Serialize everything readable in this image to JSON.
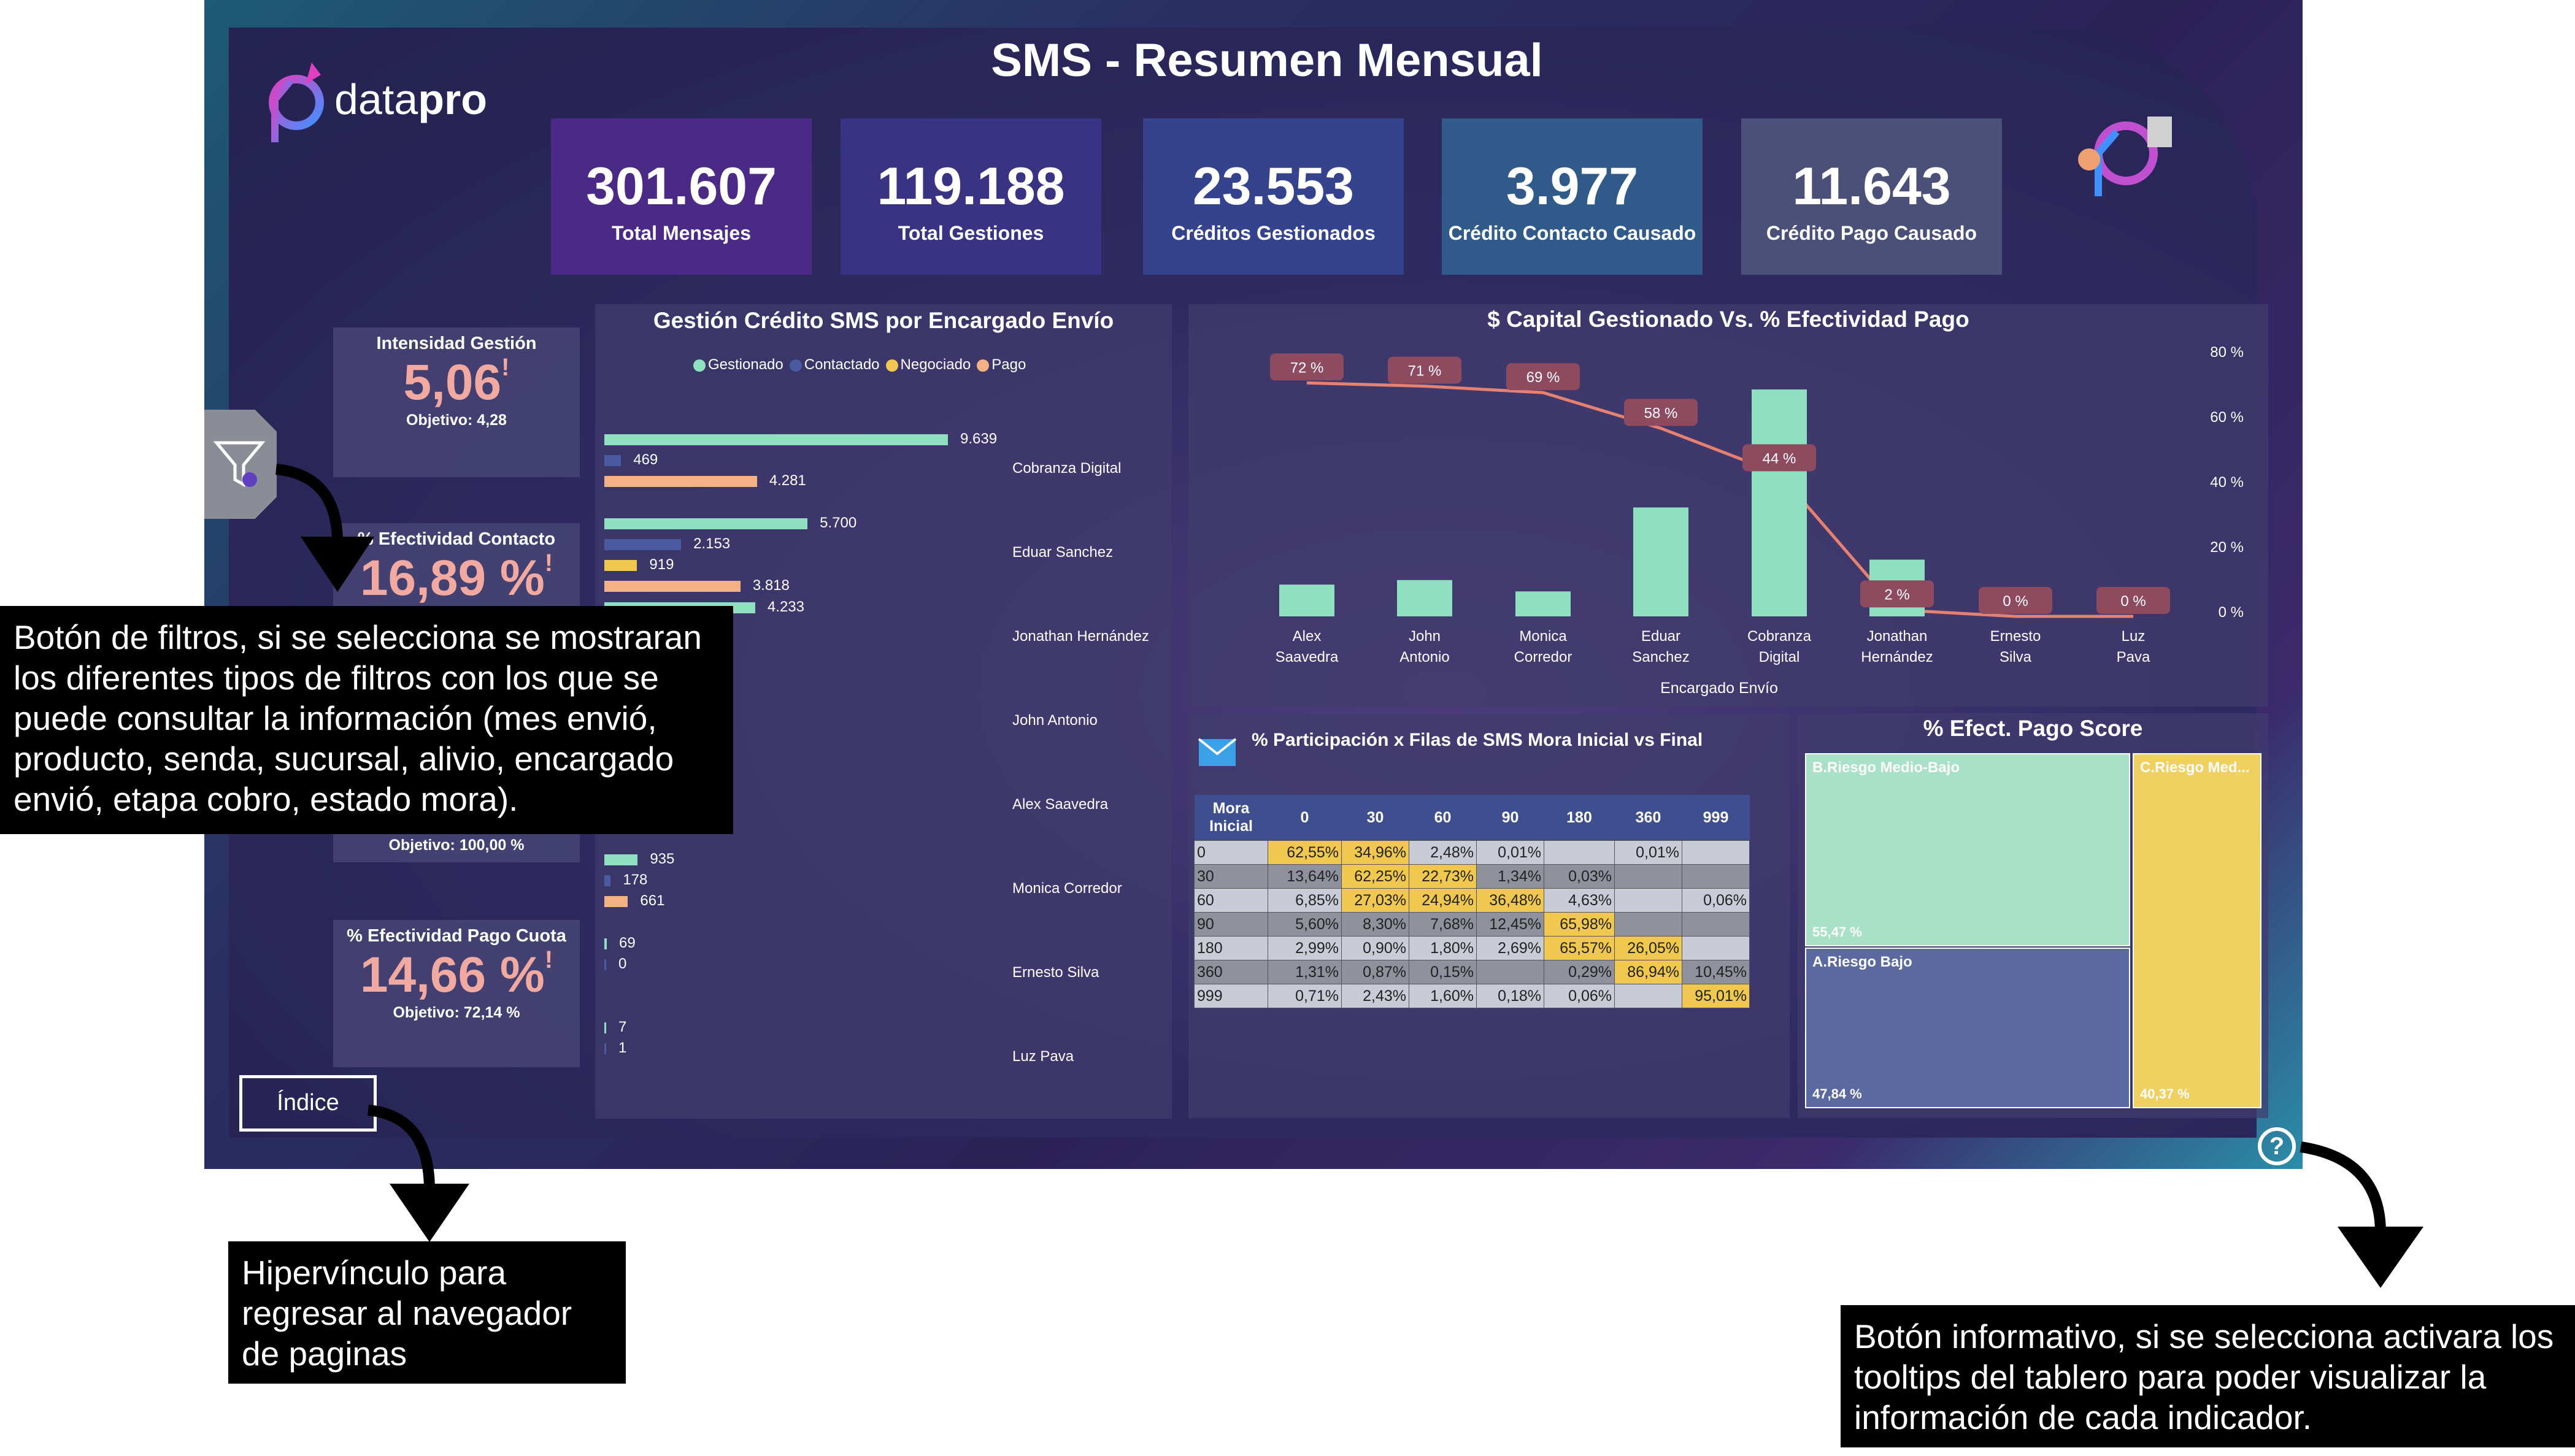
{
  "header": {
    "title": "SMS - Resumen Mensual",
    "logo_text_light": "data",
    "logo_text_bold": "pro"
  },
  "kpis": [
    {
      "value": "301.607",
      "label": "Total Mensajes",
      "color": "#4a2a86"
    },
    {
      "value": "119.188",
      "label": "Total Gestiones",
      "color": "#3a3383"
    },
    {
      "value": "23.553",
      "label": "Créditos Gestionados",
      "color": "#35438f"
    },
    {
      "value": "3.977",
      "label": "Crédito Contacto Causado",
      "color": "#2f5a8a"
    },
    {
      "value": "11.643",
      "label": "Crédito Pago Causado",
      "color": "#4a5078"
    }
  ],
  "side_cards": {
    "intensidad": {
      "title": "Intensidad Gestión",
      "value": "5,06",
      "objective": "Objetivo: 4,28"
    },
    "contacto": {
      "title": "% Efectividad Contacto",
      "value": "16,89 %"
    },
    "third": {
      "objective": "Objetivo: 100,00 %"
    },
    "pago_cuota": {
      "title": "% Efectividad Pago Cuota",
      "value": "14,66 %",
      "objective": "Objetivo: 72,14 %"
    },
    "alert_mark": "!"
  },
  "gestion_chart": {
    "title": "Gestión Crédito SMS por Encargado Envío",
    "legend": [
      "Gestionado",
      "Contactado",
      "Negociado",
      "Pago"
    ],
    "colors": {
      "gestionado": "#8fe0c0",
      "contactado": "#4a5aa0",
      "negociado": "#f0c850",
      "pago": "#f4b183"
    },
    "encargados": [
      "Cobranza Digital",
      "Eduar Sanchez",
      "Jonathan Hernández",
      "John Antonio",
      "Alex Saavedra",
      "Monica Corredor",
      "Ernesto Silva",
      "Luz Pava"
    ],
    "rows": [
      {
        "gestionado": 9639,
        "contactado": 469,
        "pago": 4281,
        "labels": [
          "9.639",
          "469",
          "4.281"
        ]
      },
      {
        "gestionado": 5700,
        "contactado": 2153,
        "negociado": 919,
        "pago": 3818,
        "labels": [
          "5.700",
          "2.153",
          "919",
          "3.818"
        ]
      },
      {
        "gestionado": 4233,
        "labels": [
          "4.233"
        ]
      },
      {},
      {},
      {
        "gestionado": 935,
        "contactado": 178,
        "pago": 661,
        "labels": [
          "935",
          "178",
          "661"
        ]
      },
      {
        "gestionado": 69,
        "contactado": 0,
        "labels": [
          "69",
          "0"
        ]
      },
      {
        "gestionado": 7,
        "contactado": 1,
        "labels": [
          "7",
          "1"
        ]
      }
    ]
  },
  "chart_data": {
    "type": "bar",
    "title": "$ Capital Gestionado Vs. % Efectividad Pago",
    "xlabel": "Encargado Envío",
    "categories": [
      "Alex Saavedra",
      "John Antonio",
      "Monica Corredor",
      "Eduar Sanchez",
      "Cobranza Digital",
      "Jonathan Hernández",
      "Ernesto Silva",
      "Luz Pava"
    ],
    "bars": [
      14,
      16,
      11,
      48,
      100,
      25,
      0,
      0
    ],
    "line": [
      72,
      71,
      69,
      58,
      44,
      2,
      0,
      0
    ],
    "line_labels": [
      "72 %",
      "71 %",
      "69 %",
      "58 %",
      "44 %",
      "2 %",
      "0 %",
      "0 %"
    ],
    "y2_ticks": [
      "80 %",
      "60 %",
      "40 %",
      "20 %",
      "0 %"
    ],
    "bar_color": "#8fe0c0",
    "line_color": "#e88070"
  },
  "mora_table": {
    "title": "% Participación x Filas de SMS Mora Inicial vs Final",
    "headers": [
      "Mora Inicial",
      "0",
      "30",
      "60",
      "90",
      "180",
      "360",
      "999"
    ],
    "rows": [
      [
        "0",
        "62,55%",
        "34,96%",
        "2,48%",
        "0,01%",
        "",
        "0,01%",
        ""
      ],
      [
        "30",
        "13,64%",
        "62,25%",
        "22,73%",
        "1,34%",
        "0,03%",
        "",
        ""
      ],
      [
        "60",
        "6,85%",
        "27,03%",
        "24,94%",
        "36,48%",
        "4,63%",
        "",
        "0,06%"
      ],
      [
        "90",
        "5,60%",
        "8,30%",
        "7,68%",
        "12,45%",
        "65,98%",
        "",
        ""
      ],
      [
        "180",
        "2,99%",
        "0,90%",
        "1,80%",
        "2,69%",
        "65,57%",
        "26,05%",
        ""
      ],
      [
        "360",
        "1,31%",
        "0,87%",
        "0,15%",
        "",
        "0,29%",
        "86,94%",
        "10,45%"
      ],
      [
        "999",
        "0,71%",
        "2,43%",
        "1,60%",
        "0,18%",
        "0,06%",
        "",
        "95,01%"
      ]
    ]
  },
  "score_chart": {
    "title": "% Efect. Pago Score",
    "blocks": [
      {
        "label": "B.Riesgo Medio-Bajo",
        "value": "55,47 %",
        "color": "#a8e0c8"
      },
      {
        "label": "A.Riesgo Bajo",
        "value": "47,84 %",
        "color": "#5a6aa0"
      },
      {
        "label": "C.Riesgo Med...",
        "value": "40,37 %",
        "color": "#f0d060"
      }
    ]
  },
  "nav": {
    "indice_label": "Índice",
    "help_label": "?"
  },
  "callouts": {
    "filters": "Botón de filtros, si se selecciona se mostraran los diferentes tipos de filtros con los que se puede consultar la información (mes envió, producto, senda, sucursal, alivio, encargado envió, etapa cobro, estado mora).",
    "index": "Hipervínculo para regresar al navegador de paginas",
    "info": "Botón informativo, si se selecciona activara los tooltips del tablero para poder visualizar la información de cada indicador."
  }
}
